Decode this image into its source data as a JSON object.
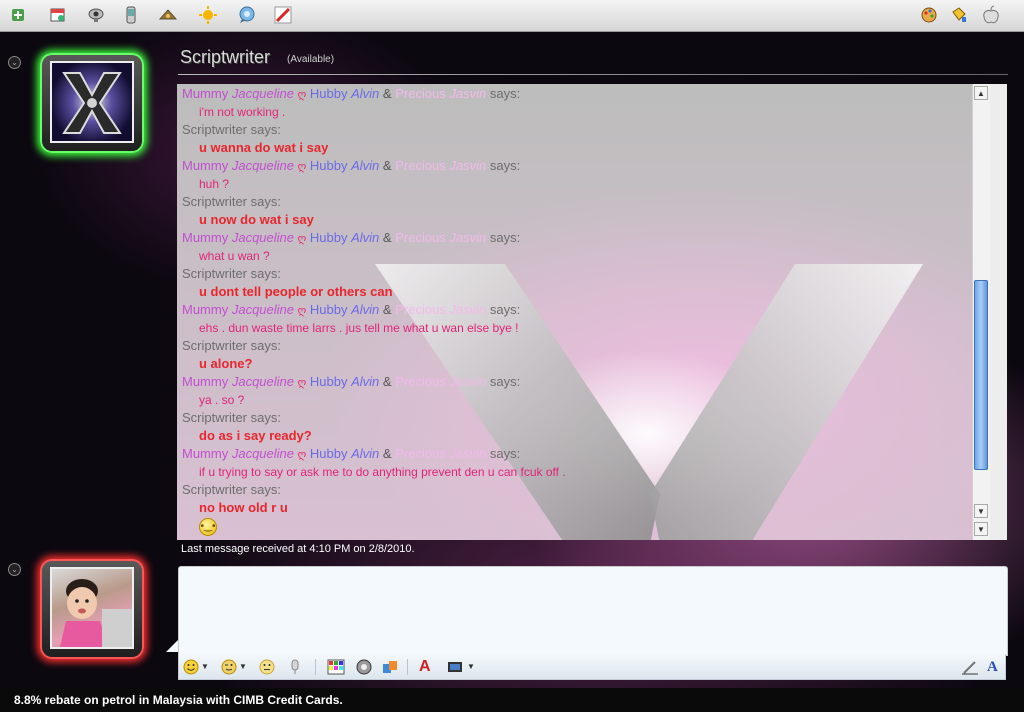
{
  "toolbar": {
    "left_icons": [
      "add-contact-icon",
      "calendar-icon",
      "webcam-icon",
      "mobile-phone-icon",
      "games-icon",
      "sun-icon",
      "chat-bubble-icon",
      "block-icon"
    ],
    "right_icons": [
      "paint-palette-icon",
      "paint-bucket-icon",
      "apple-icon"
    ]
  },
  "contact": {
    "name": "Scriptwriter",
    "status": "(Available)"
  },
  "senders": {
    "mummy": "Mummy",
    "jacqueline": "Jacqueline",
    "heart": "ღ",
    "hubby": "Hubby",
    "alvin": "Alvin",
    "amp": "&",
    "precious": "Precious",
    "jasvin": "Jasvin",
    "says": "says:",
    "scriptwriter": "Scriptwriter says:"
  },
  "messages": [
    {
      "from": "group",
      "text": "i'm not working ."
    },
    {
      "from": "scriptwriter",
      "text": "u wanna do wat i say"
    },
    {
      "from": "group",
      "text": "huh ?"
    },
    {
      "from": "scriptwriter",
      "text": "u now do wat i say"
    },
    {
      "from": "group",
      "text": "what u wan ?"
    },
    {
      "from": "scriptwriter",
      "text": "u dont tell people or others can"
    },
    {
      "from": "group",
      "text": "ehs . dun waste time larrs . jus tell me what u wan else bye !"
    },
    {
      "from": "scriptwriter",
      "text": "u alone?"
    },
    {
      "from": "group",
      "text": "ya . so ?"
    },
    {
      "from": "scriptwriter",
      "text": "do as i say ready?"
    },
    {
      "from": "group",
      "text": "if u trying to say or ask me to do anything prevent den u can fcuk off ."
    },
    {
      "from": "scriptwriter",
      "text": "no how old r u"
    }
  ],
  "last_message": "Last message received at 4:10 PM on 2/8/2010.",
  "format_bar": {
    "buttons": [
      "emoticon-icon",
      "wink-icon",
      "nudge-icon",
      "voice-clip-icon",
      "background-icon",
      "send-file-icon",
      "share-icon",
      "font-icon",
      "image-icon"
    ],
    "right": [
      "handwriting-icon",
      "font-style-icon"
    ],
    "font_glyph": "A",
    "font_style_glyph": "A"
  },
  "ad": {
    "text": "8.8% rebate on petrol in Malaysia with CIMB Credit Cards."
  },
  "colors": {
    "group_sender": "#c24fd0",
    "scriptwriter_msg": "#e8262d",
    "group_msg": "#e0247a",
    "contact_frame_glow": "#3cff3c",
    "user_frame_glow": "#ff3030"
  }
}
